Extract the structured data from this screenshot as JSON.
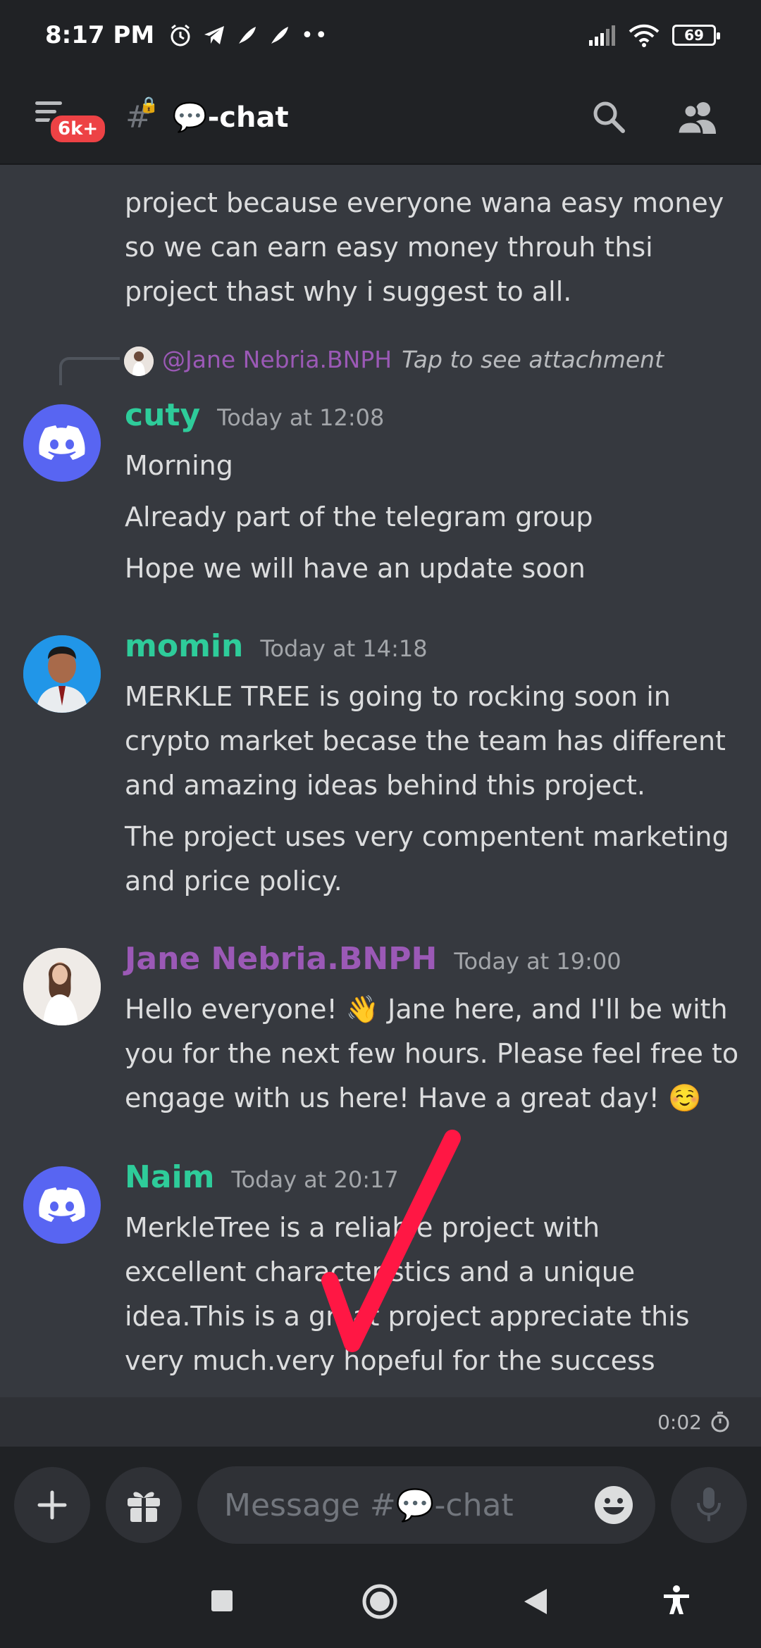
{
  "status_bar": {
    "time": "8:17 PM",
    "battery": "69",
    "left_icons": [
      "alarm-icon",
      "telegram-icon",
      "feather-icon",
      "feather-icon",
      "more-dots-icon"
    ],
    "right_icons": [
      "signal-icon",
      "wifi-icon",
      "battery-icon"
    ]
  },
  "header": {
    "badge": "6k+",
    "channel_emoji": "💬",
    "channel_name": "-chat",
    "icons": [
      "menu-icon",
      "hash-lock-icon",
      "search-icon",
      "members-icon"
    ]
  },
  "chat": {
    "continued_text": [
      "project because everyone wana easy money",
      "so we can earn easy money throuh thsi",
      "project thast why i suggest to all."
    ],
    "reply": {
      "user": "@Jane Nebria.BNPH",
      "hint": "Tap to see attachment"
    },
    "messages": [
      {
        "username": "cuty",
        "user_color": "#2ecc9a",
        "timestamp": "Today at 12:08",
        "avatar": "discord",
        "lines": [
          "Morning",
          "Already part of the telegram group",
          "Hope we will have an update soon"
        ]
      },
      {
        "username": "momin",
        "user_color": "#2ecc9a",
        "timestamp": "Today at 14:18",
        "avatar": "photo",
        "lines": [
          "MERKLE TREE is going to rocking soon in",
          "crypto market becase the team has different",
          "and amazing ideas behind this project.",
          "The project uses very compentent marketing",
          "and price policy."
        ]
      },
      {
        "username": "Jane Nebria.BNPH",
        "user_color": "#9b59b6",
        "timestamp": "Today at 19:00",
        "avatar": "photo",
        "lines": [
          "Hello everyone! 👋 Jane here, and I'll be with",
          "you for the next few hours. Please feel free to",
          "engage with us here! Have a great day! ☺️"
        ]
      },
      {
        "username": "Naim",
        "user_color": "#2ecc9a",
        "timestamp": "Today at 20:17",
        "avatar": "discord",
        "lines": [
          "MerkleTree  is a reliable project with",
          "excellent characteristics and a unique",
          "idea.This is a great project  appreciate this",
          "very much.very hopeful for the success"
        ]
      }
    ]
  },
  "timer": {
    "value": "0:02"
  },
  "composer": {
    "placeholder_prefix": "Message #",
    "placeholder_emoji": "💬",
    "placeholder_channel": "-chat"
  },
  "colors": {
    "background": "#36393f",
    "header": "#202225",
    "blurple": "#5865f2",
    "annotation_red": "#ff1744"
  }
}
